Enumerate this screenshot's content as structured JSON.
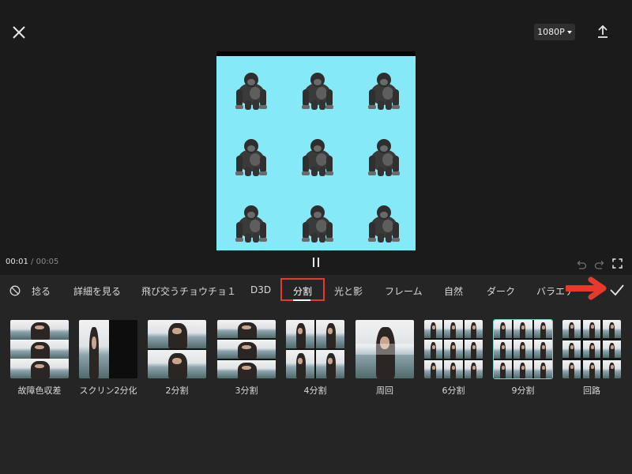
{
  "top": {
    "close_icon": "close-icon",
    "resolution": "1080P",
    "export_icon": "upload-icon"
  },
  "preview": {
    "background_color": "#86e9f8",
    "tile": "gorilla",
    "grid": "3x3"
  },
  "timeline": {
    "current_time": "00:01",
    "separator": "/",
    "total_time": "00:05"
  },
  "tabs": [
    {
      "label": "捻る"
    },
    {
      "label": "詳細を見る"
    },
    {
      "label": "飛び交うチョウチョ１"
    },
    {
      "label": "D3D"
    },
    {
      "label": "分割",
      "selected": true
    },
    {
      "label": "光と影"
    },
    {
      "label": "フレーム"
    },
    {
      "label": "自然"
    },
    {
      "label": "ダーク"
    },
    {
      "label": "バラエテ"
    }
  ],
  "effects": [
    {
      "label": "故障色収差"
    },
    {
      "label": "スクリン2分化"
    },
    {
      "label": "2分割"
    },
    {
      "label": "3分割"
    },
    {
      "label": "4分割"
    },
    {
      "label": "周回"
    },
    {
      "label": "6分割"
    },
    {
      "label": "9分割",
      "selected": true
    },
    {
      "label": "回路"
    }
  ],
  "colors": {
    "background": "#1b1b1b",
    "panel": "#252525",
    "highlight_box": "#e23a32",
    "annotation_arrow": "#e8392f",
    "selected_outline": "#7ecfc9"
  }
}
